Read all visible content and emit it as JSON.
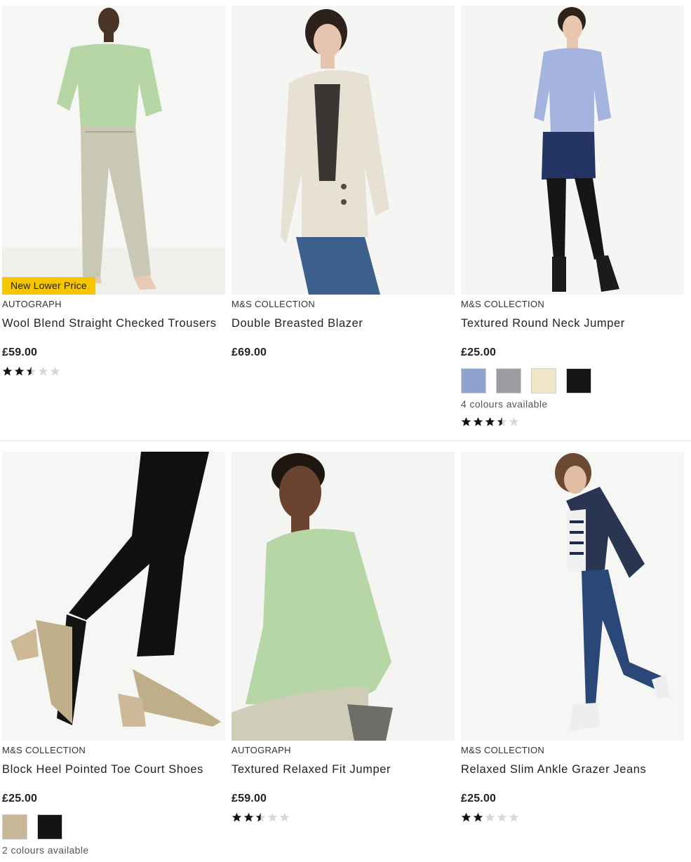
{
  "products": [
    {
      "badge": "New Lower Price",
      "brand": "AUTOGRAPH",
      "title": "Wool Blend Straight Checked Trousers",
      "price": "£59.00",
      "rating": 2.5,
      "image_icon": "model-green-jumper-checked-trousers"
    },
    {
      "brand": "M&S COLLECTION",
      "title": "Double Breasted Blazer",
      "price": "£69.00",
      "image_icon": "model-cream-blazer-jeans"
    },
    {
      "brand": "M&S COLLECTION",
      "title": "Textured Round Neck Jumper",
      "price": "£25.00",
      "swatches": [
        "#8fa3cf",
        "#9a9ca1",
        "#efe6c8",
        "#151515"
      ],
      "colours_text": "4 colours available",
      "rating": 3.5,
      "image_icon": "model-blue-jumper-navy-skirt"
    },
    {
      "brand": "M&S COLLECTION",
      "title": "Block Heel Pointed Toe Court Shoes",
      "price": "£25.00",
      "swatches": [
        "#c9b897",
        "#141414"
      ],
      "colours_text": "2 colours available",
      "image_icon": "legs-nude-block-heel-shoes"
    },
    {
      "brand": "AUTOGRAPH",
      "title": "Textured Relaxed Fit Jumper",
      "price": "£59.00",
      "rating": 2.5,
      "image_icon": "model-green-knit-jumper"
    },
    {
      "brand": "M&S COLLECTION",
      "title": "Relaxed Slim Ankle Grazer Jeans",
      "price": "£25.00",
      "rating": 2,
      "image_icon": "model-denim-jacket-jeans"
    }
  ],
  "colors": {
    "badge": "#f5c500",
    "star_filled": "#111111",
    "star_empty": "#d8d8d8"
  }
}
